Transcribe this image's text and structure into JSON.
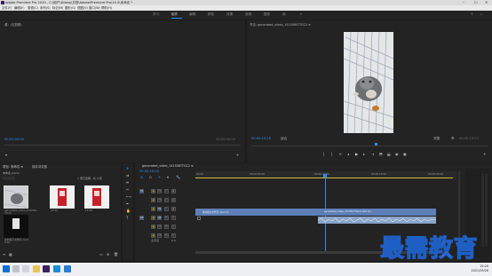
{
  "window": {
    "title": "Adobe Premiere Pro 2020 - C:\\用户\\Ddesp\\文档\\Adobe\\Premiere Pro\\14.0\\未命名 *",
    "controls": [
      "–",
      "☐",
      "✕"
    ]
  },
  "menu": [
    "文件(F)",
    "编辑(E)",
    "剪辑(C)",
    "序列(S)",
    "标记(M)",
    "图形(G)",
    "视图(V)",
    "窗口(W)",
    "帮助(H)"
  ],
  "workspaces": {
    "tabs": [
      "学习",
      "组件",
      "编辑",
      "颜色",
      "效果",
      "音频",
      "图形",
      "库"
    ],
    "active": "组件"
  },
  "source_panel": {
    "title": "源：(无剪辑)",
    "timecode_left": "00;00;00;00",
    "timecode_right": "00;00;00;00"
  },
  "program_panel": {
    "title": "节目: generated_video_1415560?TG12 ≡",
    "timecode": "00:00:10:18",
    "fit": "适合",
    "quality": "完整",
    "duration": "00:00:19:22"
  },
  "project_panel": {
    "tabs": [
      "项目: 未命名 ≡",
      "媒体浏览器"
    ],
    "path": "未命名.prproj",
    "count": "1 项已选择，共 4 项",
    "items": [
      {
        "name": "generated_video_141556...",
        "duration": "19:22"
      },
      {
        "name": "generated_video_141556...",
        "duration": "10:10"
      },
      {
        "name": "generated_video_141556...",
        "duration": "10:10"
      },
      {
        "name": "素材提示文件名.mp4",
        "duration": "9:10"
      }
    ]
  },
  "timeline": {
    "title": "generated_video_141556?TG12 ≡",
    "timecode": "00:00:10:18",
    "ruler": [
      "00:00",
      "00:00:05:00",
      "00:00:10:00",
      "00:00:15:00",
      "00:00:20:00"
    ],
    "tracks": {
      "video": [
        "V3",
        "V2",
        "V1"
      ],
      "audio": [
        "A1",
        "A2",
        "A3"
      ],
      "master": "主声道",
      "master_value": "0.0"
    },
    "clips": {
      "v1_left": "素材提示文件名.mp4 [V]",
      "v1_right": "generated_video_141556?TG12.mp4 [V]"
    }
  },
  "taskbar": {
    "time": "15:20",
    "date": "2021/09/26"
  },
  "watermark": "最需教育",
  "colors": {
    "accent": "#2d8ceb",
    "clip_video": "#5d7fb6",
    "clip_audio": "#8aa3c9",
    "playhead": "#2d8ceb"
  }
}
